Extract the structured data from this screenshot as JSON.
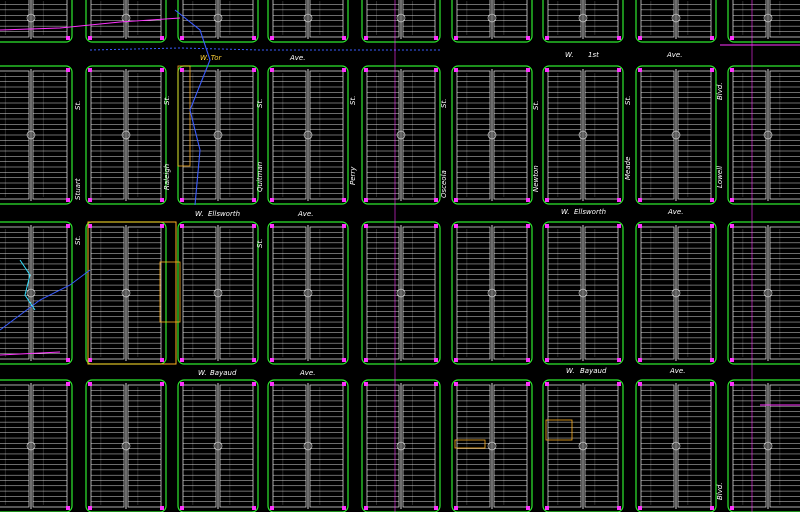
{
  "title": "",
  "colors": {
    "background": "#000000",
    "block_outline": "#2ee82e",
    "lot_lines": "#f2f2f2",
    "street_labels": "#ffffff",
    "utility_blue": "#3a5cff",
    "utility_magenta": "#ff33ff",
    "parcel_orange": "#ffb020"
  },
  "streets": {
    "h1a": "W. Tor",
    "h1b": "Ave.",
    "h1c": "W.",
    "h1d": "1st",
    "h1e": "Ave.",
    "h2a": "W.",
    "h2b": "Ellsworth",
    "h2c": "Ave.",
    "h2d": "W.",
    "h2e": "Ellsworth",
    "h2f": "Ave.",
    "h3a": "W.",
    "h3b": "Bayaud",
    "h3c": "Ave.",
    "h3d": "W.",
    "h3e": "Bayaud",
    "h3f": "Ave.",
    "v_stuart": "Stuart",
    "v_raleigh": "Raleigh",
    "v_quitman": "Quitman",
    "v_perry": "Perry",
    "v_osceola": "Osceola",
    "v_newton": "Newton",
    "v_meade": "Meade",
    "v_lowell": "Lowell",
    "st1": "St.",
    "st2": "St.",
    "st3": "St.",
    "st4": "St.",
    "st5": "St.",
    "st6": "St.",
    "st7": "St.",
    "st8": "St.",
    "st9": "St.",
    "blvd1": "Blvd.",
    "blvd2": "Blvd."
  }
}
